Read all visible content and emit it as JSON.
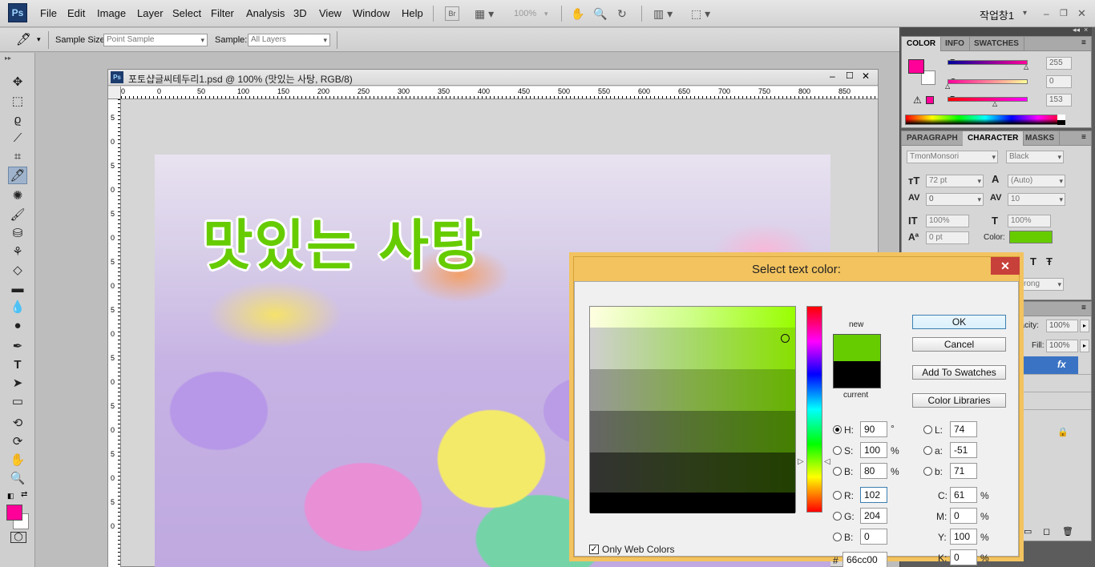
{
  "app": {
    "logo": "Ps",
    "workspace": "작업창1",
    "menus": [
      "File",
      "Edit",
      "Image",
      "Layer",
      "Select",
      "Filter",
      "Analysis",
      "3D",
      "View",
      "Window",
      "Help"
    ],
    "zoom": "100%",
    "bridge": "Br"
  },
  "options": {
    "sample_size_label": "Sample Size:",
    "sample_size_value": "Point Sample",
    "sample_label": "Sample:",
    "sample_value": "All Layers"
  },
  "document": {
    "title": "포토샵글씨테두리1.psd @ 100% (맛있는 사탕, RGB/8)",
    "canvas_text": "맛있는 사탕",
    "ruler_h": [
      "0",
      "0",
      "50",
      "100",
      "150",
      "200",
      "250",
      "300",
      "350",
      "400",
      "450",
      "500",
      "550",
      "600",
      "650",
      "700",
      "750",
      "800",
      "850"
    ],
    "ruler_v": [
      "5",
      "0",
      "5",
      "0",
      "5",
      "0",
      "5",
      "0",
      "5",
      "0",
      "5",
      "0",
      "5",
      "0",
      "5",
      "0",
      "5",
      "0"
    ]
  },
  "color_panel": {
    "tabs": [
      "COLOR",
      "INFO",
      "SWATCHES"
    ],
    "fg": "#ff0099",
    "r_label": "R",
    "r": "255",
    "g_label": "G",
    "g": "0",
    "b_label": "B",
    "b": "153"
  },
  "character_panel": {
    "tabs": [
      "PARAGRAPH",
      "CHARACTER",
      "MASKS"
    ],
    "font_family": "TmonMonsori",
    "font_style": "Black",
    "size": "72 pt",
    "leading": "(Auto)",
    "kerning": "0",
    "tracking": "10",
    "vscale": "100%",
    "hscale": "100%",
    "baseline": "0 pt",
    "color_label": "Color:",
    "color": "#66cc00",
    "aa": "rong"
  },
  "layers_panel": {
    "opacity_label": "pacity:",
    "opacity": "100%",
    "fill_label": "Fill:",
    "fill": "100%",
    "fx": "fx"
  },
  "dialog": {
    "title": "Select text color:",
    "new_label": "new",
    "current_label": "current",
    "new_color": "#66cc00",
    "current_color": "#000000",
    "ok": "OK",
    "cancel": "Cancel",
    "add_swatches": "Add To Swatches",
    "libraries": "Color Libraries",
    "h_label": "H:",
    "h": "90",
    "h_unit": "°",
    "s_label": "S:",
    "s": "100",
    "s_unit": "%",
    "bri_label": "B:",
    "bri": "80",
    "bri_unit": "%",
    "r_label": "R:",
    "r": "102",
    "g_label": "G:",
    "g": "204",
    "b_label": "B:",
    "b": "0",
    "l_label": "L:",
    "l": "74",
    "a_label": "a:",
    "a": "-51",
    "lb_label": "b:",
    "lb": "71",
    "c_label": "C:",
    "c": "61",
    "c_unit": "%",
    "m_label": "M:",
    "m": "0",
    "m_unit": "%",
    "y_label": "Y:",
    "y": "100",
    "y_unit": "%",
    "k_label": "K:",
    "k": "0",
    "k_unit": "%",
    "hex_label": "#",
    "hex": "66cc00",
    "web_colors_label": "Only Web Colors",
    "web_colors_checked": true
  }
}
